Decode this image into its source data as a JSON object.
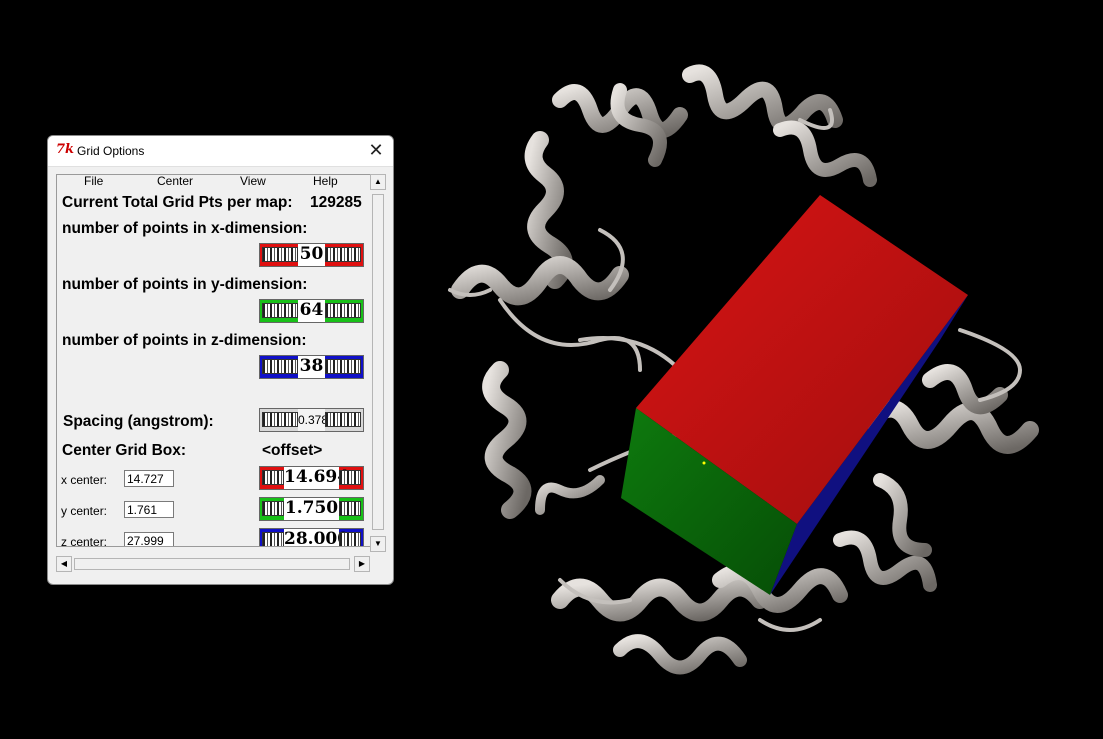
{
  "window": {
    "title": "Grid Options",
    "icon": "tk-feather-icon",
    "icon_glyph": "7k"
  },
  "menu": [
    "File",
    "Center",
    "View",
    "Help"
  ],
  "total": {
    "label": "Current Total Grid Pts per map:",
    "value": "129285"
  },
  "dims": {
    "x": {
      "label": "number of points in x-dimension:",
      "value": "50"
    },
    "y": {
      "label": "number of points in y-dimension:",
      "value": "64"
    },
    "z": {
      "label": "number of points in z-dimension:",
      "value": "38"
    }
  },
  "spacing": {
    "label": "Spacing (angstrom):",
    "value": "0.378"
  },
  "center": {
    "label": "Center Grid Box:",
    "offset_label": "<offset>",
    "x": {
      "label": "x center:",
      "value": "14.727",
      "offset": "14.694"
    },
    "y": {
      "label": "y center:",
      "value": "1.761",
      "offset": "1.750"
    },
    "z": {
      "label": "z center:",
      "value": "27.999",
      "offset": "28.000"
    }
  },
  "colors": {
    "red": "#e01010",
    "green": "#18c018",
    "blue": "#1010c8",
    "box_top": "#c01010",
    "box_side": "#0a6e0a",
    "box_edge": "#101080",
    "ribbon": "#b8b4b0"
  }
}
